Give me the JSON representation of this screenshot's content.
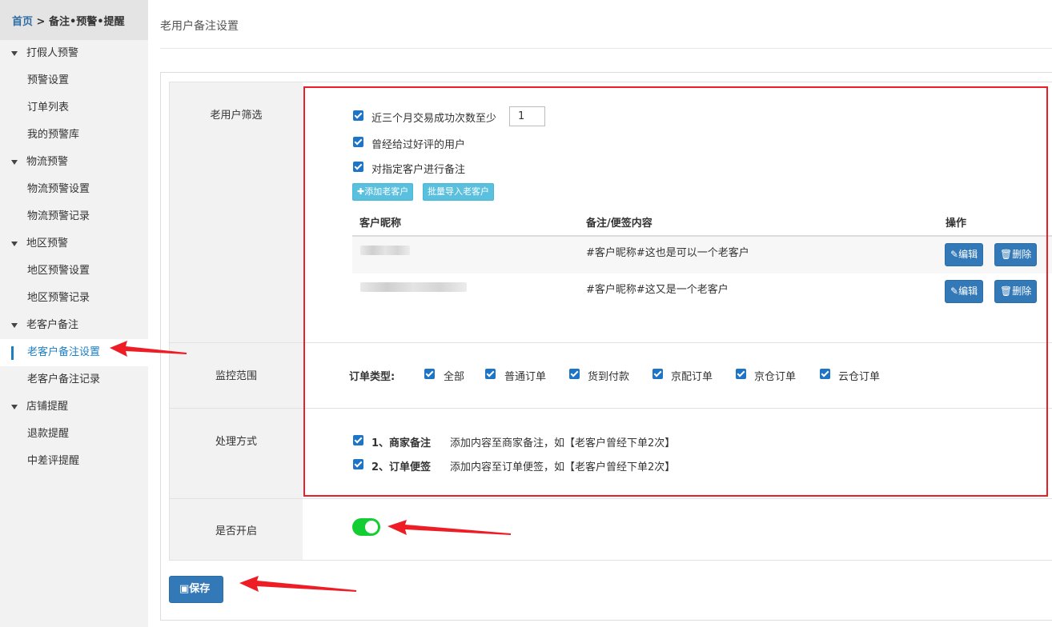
{
  "breadcrumb": {
    "home": "首页",
    "sep": ">",
    "current": "备注•预警•提醒"
  },
  "sidebar": {
    "groups": [
      {
        "label": "打假人预警",
        "items": [
          "预警设置",
          "订单列表",
          "我的预警库"
        ]
      },
      {
        "label": "物流预警",
        "items": [
          "物流预警设置",
          "物流预警记录"
        ]
      },
      {
        "label": "地区预警",
        "items": [
          "地区预警设置",
          "地区预警记录"
        ]
      },
      {
        "label": "老客户备注",
        "items": [
          "老客户备注设置",
          "老客户备注记录"
        ]
      },
      {
        "label": "店铺提醒",
        "items": [
          "退款提醒",
          "中差评提醒"
        ]
      }
    ],
    "active_item": "老客户备注设置"
  },
  "page_title": "老用户备注设置",
  "filter": {
    "label": "老用户筛选",
    "opt1": "近三个月交易成功次数至少",
    "opt1_value": "1",
    "opt2": "曾经给过好评的用户",
    "opt3": "对指定客户进行备注",
    "add_btn": "添加老客户",
    "import_btn": "批量导入老客户",
    "table": {
      "headers": [
        "客户昵称",
        "备注/便签内容",
        "操作"
      ],
      "rows": [
        {
          "nick": "",
          "note": "#客户昵称#这也是可以一个老客户"
        },
        {
          "nick": "",
          "note": "#客户昵称#这又是一个老客户"
        }
      ],
      "edit_btn": "编辑",
      "delete_btn": "删除"
    }
  },
  "scope": {
    "label": "监控范围",
    "type_label": "订单类型:",
    "options": [
      "全部",
      "普通订单",
      "货到付款",
      "京配订单",
      "京仓订单",
      "云仓订单"
    ]
  },
  "handle": {
    "label": "处理方式",
    "items": [
      {
        "title": "1、商家备注",
        "desc": "添加内容至商家备注，如【老客户曾经下单2次】"
      },
      {
        "title": "2、订单便签",
        "desc": "添加内容至订单便签，如【老客户曾经下单2次】"
      }
    ]
  },
  "enable": {
    "label": "是否开启",
    "on": true
  },
  "save_btn": "保存",
  "colors": {
    "primary": "#3379b7",
    "info": "#5bc0de",
    "toggle_on": "#13ce32",
    "annotation": "#ee1c24"
  }
}
